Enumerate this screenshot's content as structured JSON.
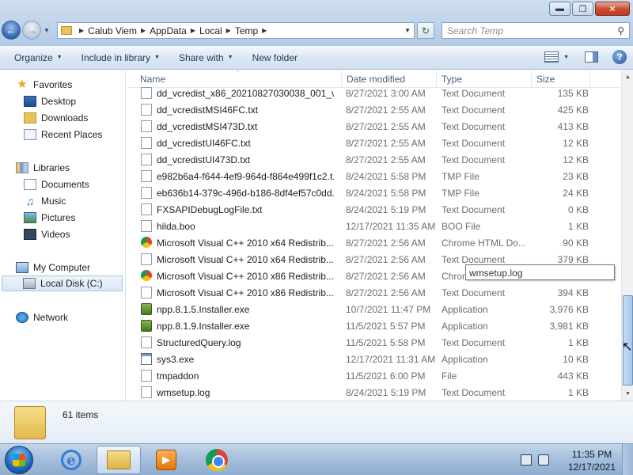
{
  "window": {
    "minimize_icon": "minimize-icon",
    "maximize_icon": "restore-icon",
    "close_icon": "close-icon"
  },
  "address_bar": {
    "crumbs": [
      "Calub Viem",
      "AppData",
      "Local",
      "Temp"
    ]
  },
  "search": {
    "placeholder": "Search Temp"
  },
  "toolbar": {
    "organize": "Organize",
    "include_in_library": "Include in library",
    "share_with": "Share with",
    "new_folder": "New folder"
  },
  "nav_pane": {
    "favorites": "Favorites",
    "desktop": "Desktop",
    "downloads": "Downloads",
    "recent_places": "Recent Places",
    "libraries": "Libraries",
    "documents": "Documents",
    "music": "Music",
    "pictures": "Pictures",
    "videos": "Videos",
    "my_computer": "My Computer",
    "local_disk": "Local Disk (C:)",
    "network": "Network"
  },
  "columns": {
    "name": "Name",
    "date": "Date modified",
    "type": "Type",
    "size": "Size"
  },
  "files": [
    {
      "name": "dd_vcredist_x86_20210827030038_001_vc...",
      "date": "8/27/2021 3:00 AM",
      "type": "Text Document",
      "size": "135 KB",
      "icon": "text-file-icon"
    },
    {
      "name": "dd_vcredistMSI46FC.txt",
      "date": "8/27/2021 2:55 AM",
      "type": "Text Document",
      "size": "425 KB",
      "icon": "text-file-icon"
    },
    {
      "name": "dd_vcredistMSI473D.txt",
      "date": "8/27/2021 2:55 AM",
      "type": "Text Document",
      "size": "413 KB",
      "icon": "text-file-icon"
    },
    {
      "name": "dd_vcredistUI46FC.txt",
      "date": "8/27/2021 2:55 AM",
      "type": "Text Document",
      "size": "12 KB",
      "icon": "text-file-icon"
    },
    {
      "name": "dd_vcredistUI473D.txt",
      "date": "8/27/2021 2:55 AM",
      "type": "Text Document",
      "size": "12 KB",
      "icon": "text-file-icon"
    },
    {
      "name": "e982b6a4-f644-4ef9-964d-f864e499f1c2.t...",
      "date": "8/24/2021 5:58 PM",
      "type": "TMP File",
      "size": "23 KB",
      "icon": "generic-file-icon"
    },
    {
      "name": "eb636b14-379c-496d-b186-8df4ef57c0dd...",
      "date": "8/24/2021 5:58 PM",
      "type": "TMP File",
      "size": "24 KB",
      "icon": "generic-file-icon"
    },
    {
      "name": "FXSAPIDebugLogFile.txt",
      "date": "8/24/2021 5:19 PM",
      "type": "Text Document",
      "size": "0 KB",
      "icon": "text-file-icon"
    },
    {
      "name": "hilda.boo",
      "date": "12/17/2021 11:35 AM",
      "type": "BOO File",
      "size": "1 KB",
      "icon": "generic-file-icon"
    },
    {
      "name": "Microsoft Visual C++ 2010  x64 Redistrib...",
      "date": "8/27/2021 2:56 AM",
      "type": "Chrome HTML Do...",
      "size": "90 KB",
      "icon": "chrome-icon"
    },
    {
      "name": "Microsoft Visual C++ 2010  x64 Redistrib...",
      "date": "8/27/2021 2:56 AM",
      "type": "Text Document",
      "size": "379 KB",
      "icon": "text-file-icon"
    },
    {
      "name": "Microsoft Visual C++ 2010  x86 Redistrib...",
      "date": "8/27/2021 2:56 AM",
      "type": "Chrom",
      "size": "",
      "icon": "chrome-icon"
    },
    {
      "name": "Microsoft Visual C++ 2010  x86 Redistrib...",
      "date": "8/27/2021 2:56 AM",
      "type": "Text Document",
      "size": "394 KB",
      "icon": "text-file-icon"
    },
    {
      "name": "npp.8.1.5.Installer.exe",
      "date": "10/7/2021 11:47 PM",
      "type": "Application",
      "size": "3,976 KB",
      "icon": "installer-icon"
    },
    {
      "name": "npp.8.1.9.Installer.exe",
      "date": "11/5/2021 5:57 PM",
      "type": "Application",
      "size": "3,981 KB",
      "icon": "installer-icon"
    },
    {
      "name": "StructuredQuery.log",
      "date": "11/5/2021 5:58 PM",
      "type": "Text Document",
      "size": "1 KB",
      "icon": "text-file-icon"
    },
    {
      "name": "sys3.exe",
      "date": "12/17/2021 11:31 AM",
      "type": "Application",
      "size": "10 KB",
      "icon": "exe-icon"
    },
    {
      "name": "tmpaddon",
      "date": "11/5/2021 6:00 PM",
      "type": "File",
      "size": "443 KB",
      "icon": "generic-file-icon"
    },
    {
      "name": "wmsetup.log",
      "date": "8/24/2021 5:19 PM",
      "type": "Text Document",
      "size": "1 KB",
      "icon": "text-file-icon"
    }
  ],
  "tooltip": "wmsetup.log",
  "details": {
    "item_count": "61 items"
  },
  "taskbar": {
    "time": "11:35 PM",
    "date": "12/17/2021",
    "pinned": [
      "internet-explorer-icon",
      "windows-explorer-icon",
      "media-player-icon",
      "chrome-icon"
    ]
  }
}
